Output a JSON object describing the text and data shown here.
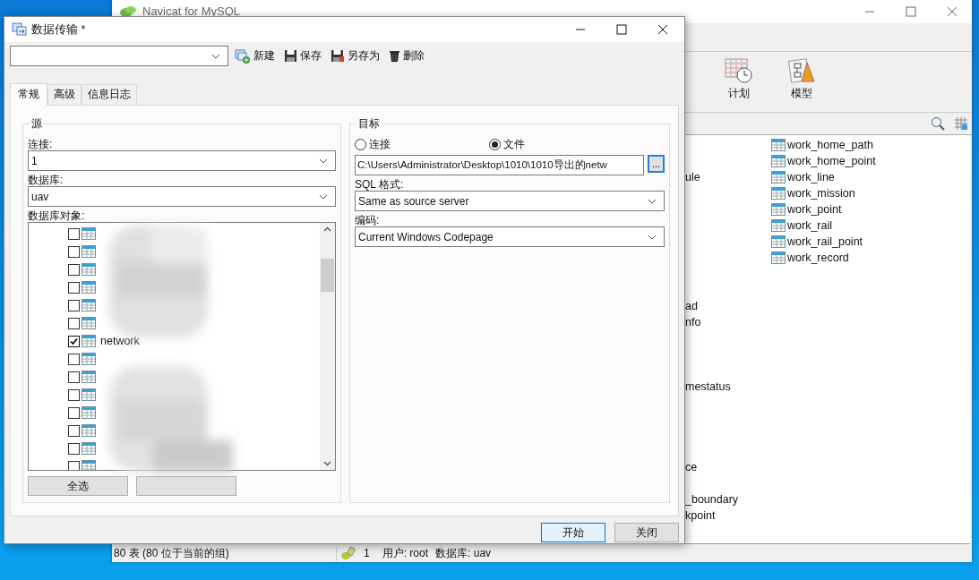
{
  "main_window": {
    "title": "Navicat for MySQL",
    "toolbar": [
      {
        "label": "计划",
        "kind": "schedule"
      },
      {
        "label": "模型",
        "kind": "model"
      }
    ],
    "list_left": [
      {
        "text": "ule"
      },
      {
        "text": "ad"
      },
      {
        "text": "nfo"
      },
      {
        "text": "mestatus"
      },
      {
        "text": "ce"
      },
      {
        "text": "_boundary"
      },
      {
        "text": "kpoint"
      }
    ],
    "list_right": [
      {
        "text": "work_home_path"
      },
      {
        "text": "work_home_point"
      },
      {
        "text": "work_line"
      },
      {
        "text": "work_mission"
      },
      {
        "text": "work_point"
      },
      {
        "text": "work_rail"
      },
      {
        "text": "work_rail_point"
      },
      {
        "text": "work_record"
      }
    ],
    "status_bar": {
      "tables": "80 表 (80 位于当前的组)",
      "connection": "1",
      "user": "用户: root",
      "database": "数据库: uav"
    }
  },
  "dialog": {
    "title": "数据传输 *",
    "toolbar": [
      {
        "label": "新建",
        "kind": "new"
      },
      {
        "label": "保存",
        "kind": "save"
      },
      {
        "label": "另存为",
        "kind": "save_as"
      },
      {
        "label": "删除",
        "kind": "delete"
      }
    ],
    "tabs": [
      {
        "label": "常规",
        "selected": true
      },
      {
        "label": "高级",
        "selected": false
      },
      {
        "label": "信息日志",
        "selected": false
      }
    ],
    "source": {
      "title": "源",
      "connection_label": "连接:",
      "connection": "1",
      "database_label": "数据库:",
      "database": "uav",
      "objects_label": "数据库对象:",
      "objects": [
        {
          "checked": false
        },
        {
          "checked": false
        },
        {
          "checked": false
        },
        {
          "checked": false
        },
        {
          "checked": false
        },
        {
          "checked": false
        },
        {
          "name": "network",
          "checked": true
        },
        {
          "checked": false
        },
        {
          "checked": false
        },
        {
          "checked": false
        },
        {
          "checked": false
        },
        {
          "checked": false
        },
        {
          "checked": false
        },
        {
          "checked": false
        }
      ],
      "select_all": "全选"
    },
    "target": {
      "title": "目标",
      "options": [
        {
          "label": "连接",
          "selected": false
        },
        {
          "label": "文件",
          "selected": true
        }
      ],
      "path": "C:\\Users\\Administrator\\Desktop\\1010\\1010导出的netw",
      "browse": "...",
      "sql_format_label": "SQL 格式:",
      "sql_format": "Same as source server",
      "encoding_label": "编码:",
      "encoding": "Current Windows Codepage"
    },
    "buttons": [
      {
        "label": "开始",
        "default": true
      },
      {
        "label": "关闭",
        "default": false
      }
    ]
  }
}
